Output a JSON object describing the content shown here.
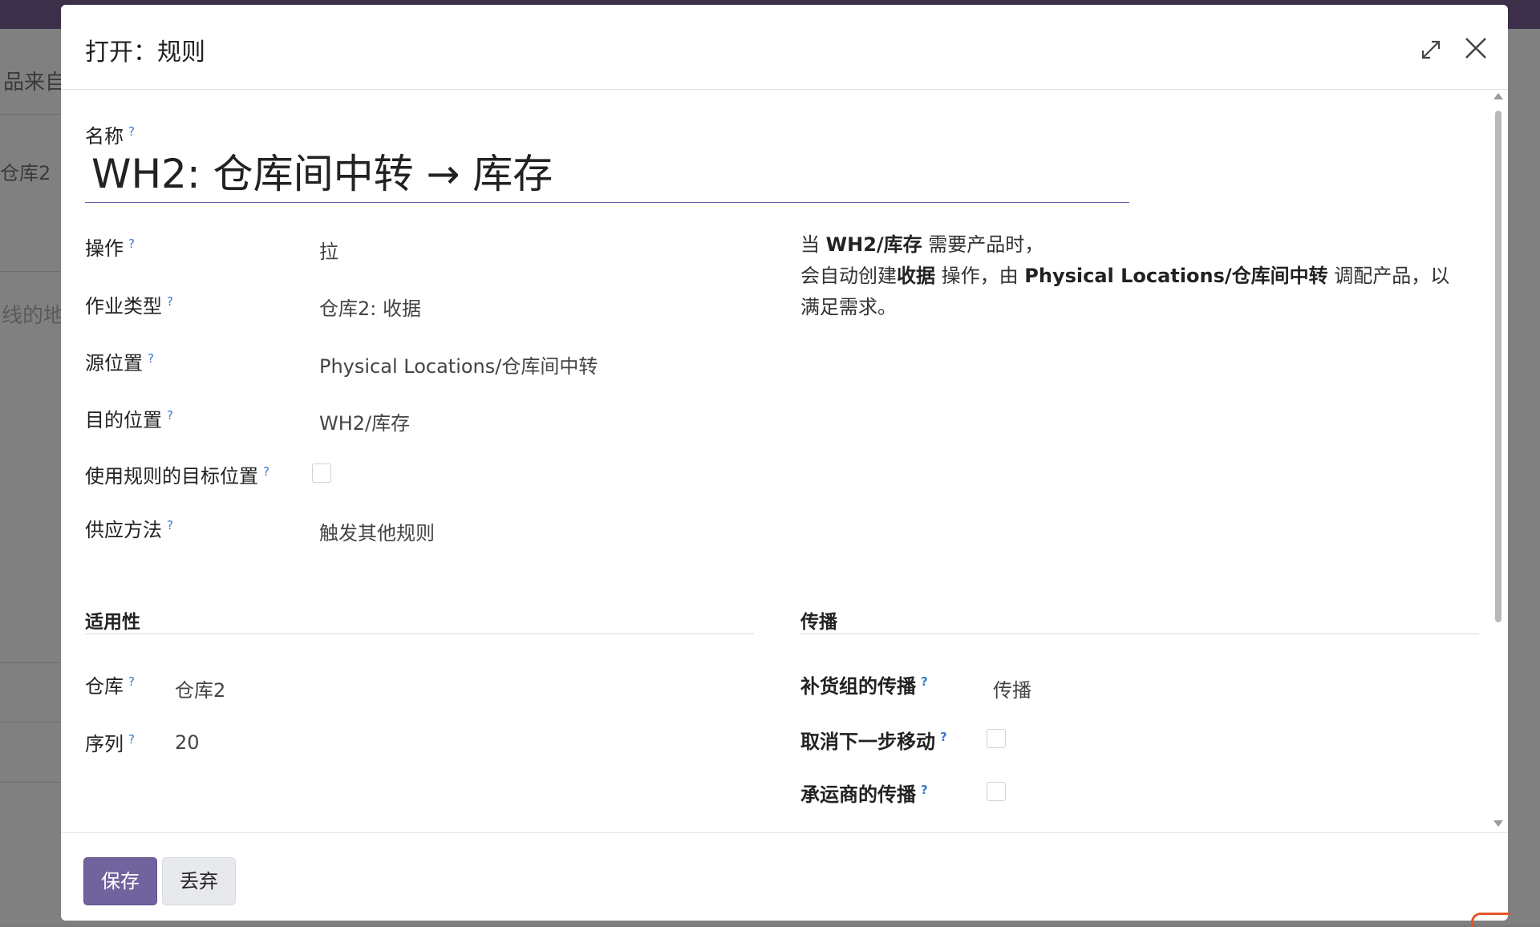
{
  "background": {
    "texts": [
      "品来自",
      "仓库2",
      "线的地"
    ]
  },
  "modal": {
    "title": "打开：规则",
    "name_label": "名称",
    "name_value": "WH2: 仓库间中转 → 库存",
    "fields": [
      {
        "label": "操作",
        "value": "拉"
      },
      {
        "label": "作业类型",
        "value": "仓库2: 收据"
      },
      {
        "label": "源位置",
        "value": "Physical Locations/仓库间中转"
      },
      {
        "label": "目的位置",
        "value": "WH2/库存"
      },
      {
        "label": "使用规则的目标位置",
        "value": ""
      },
      {
        "label": "供应方法",
        "value": "触发其他规则"
      }
    ],
    "description": {
      "line1_pre": "当 ",
      "line1_bold": "WH2/库存",
      "line1_post": " 需要产品时，",
      "line2_pre": "会自动创建",
      "line2_bold1": "收据",
      "line2_mid": " 操作，由 ",
      "line2_bold2": "Physical Locations/仓库间中转",
      "line2_post": " 调配产品，以",
      "line3": "满足需求。"
    },
    "applicability": {
      "title": "适用性",
      "warehouse_label": "仓库",
      "warehouse_value": "仓库2",
      "sequence_label": "序列",
      "sequence_value": "20"
    },
    "propagation": {
      "title": "传播",
      "group_label": "补货组的传播",
      "group_value": "传播",
      "cancel_next_label": "取消下一步移动",
      "carrier_label": "承运商的传播"
    },
    "help_mark": "?",
    "buttons": {
      "save": "保存",
      "discard": "丢弃"
    },
    "colors": {
      "primary": "#71639e",
      "help": "#3a78c9"
    }
  }
}
